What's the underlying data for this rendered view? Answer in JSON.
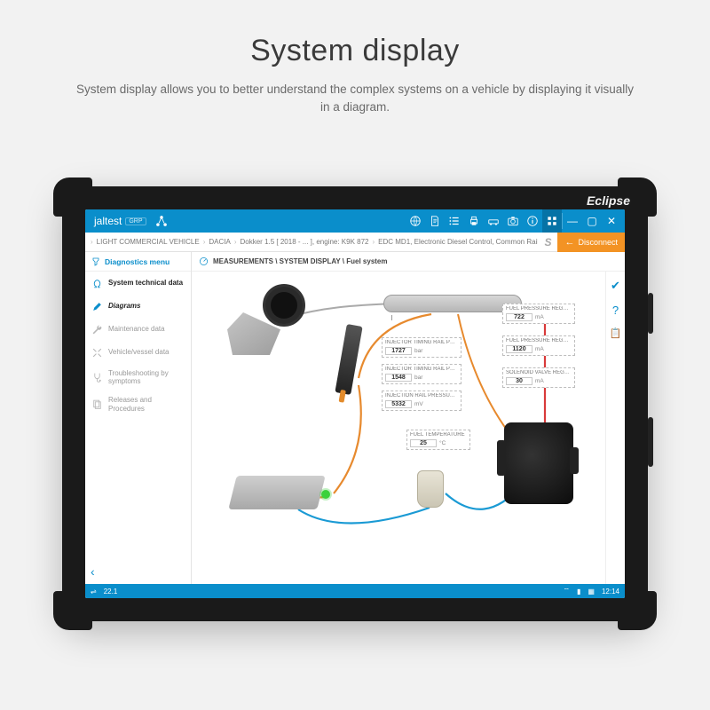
{
  "hero": {
    "title": "System display",
    "subtitle": "System display allows you to better understand the complex systems on a vehicle by displaying it visually in a diagram."
  },
  "device": {
    "brand": "Eclipse"
  },
  "topbar": {
    "product": "jaltest",
    "badge": "GRP"
  },
  "breadcrumb": {
    "segments": [
      "LIGHT COMMERCIAL VEHICLE",
      "DACIA",
      "Dokker 1.5 [ 2018 - ... ], engine: K9K 872",
      "EDC MD1, Electronic Diesel Control, Common Rail"
    ],
    "disconnect": "Disconnect"
  },
  "sidebar": {
    "header": "Diagnostics menu",
    "items": [
      {
        "label": "System technical data"
      },
      {
        "label": "Diagrams"
      },
      {
        "label": "Maintenance data"
      },
      {
        "label": "Vehicle/vessel data"
      },
      {
        "label": "Troubleshooting by symptoms"
      },
      {
        "label": "Releases and Procedures"
      }
    ]
  },
  "content": {
    "title": "MEASUREMENTS \\ SYSTEM DISPLAY \\ Fuel system"
  },
  "boxes": {
    "b1": {
      "label": "INJECTOR TIMING RAIL PRESSURE",
      "value": "1727",
      "unit": "bar"
    },
    "b2": {
      "label": "INJECTOR TIMING RAIL PRESSURE, NOMINAL VA...",
      "value": "1548",
      "unit": "bar"
    },
    "b3": {
      "label": "INJECTION RAIL PRESSURE SENSOR, SIGNAL VOLTAGE",
      "value": "5332",
      "unit": "mV"
    },
    "b4": {
      "label": "FUEL PRESSURE REGULATOR, CURRENT...",
      "value": "722",
      "unit": "mA"
    },
    "b5": {
      "label": "FUEL PRESSURE REGULATOR, CURRENT...",
      "value": "1120",
      "unit": "mA"
    },
    "b6": {
      "label": "SOLENOID VALVE REGULATING THE AMO...",
      "value": "30",
      "unit": "mA"
    },
    "b7": {
      "label": "FUEL TEMPERATURE",
      "value": "25",
      "unit": "°C"
    }
  },
  "status": {
    "version": "22.1",
    "time": "12:14"
  }
}
